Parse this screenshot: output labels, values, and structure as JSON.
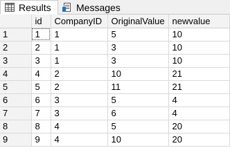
{
  "tabs": [
    {
      "label": "Results",
      "icon": "grid-icon"
    },
    {
      "label": "Messages",
      "icon": "messages-icon"
    }
  ],
  "grid": {
    "columns": [
      "id",
      "CompanyID",
      "OriginalValue",
      "newvalue"
    ],
    "rows": [
      {
        "num": "1",
        "cells": [
          "1",
          "1",
          "5",
          "10"
        ]
      },
      {
        "num": "2",
        "cells": [
          "2",
          "1",
          "3",
          "10"
        ]
      },
      {
        "num": "3",
        "cells": [
          "3",
          "1",
          "3",
          "10"
        ]
      },
      {
        "num": "4",
        "cells": [
          "4",
          "2",
          "10",
          "21"
        ]
      },
      {
        "num": "5",
        "cells": [
          "5",
          "2",
          "11",
          "21"
        ]
      },
      {
        "num": "6",
        "cells": [
          "6",
          "3",
          "5",
          "4"
        ]
      },
      {
        "num": "7",
        "cells": [
          "7",
          "3",
          "6",
          "4"
        ]
      },
      {
        "num": "8",
        "cells": [
          "8",
          "4",
          "5",
          "20"
        ]
      },
      {
        "num": "9",
        "cells": [
          "9",
          "4",
          "10",
          "20"
        ]
      }
    ]
  }
}
